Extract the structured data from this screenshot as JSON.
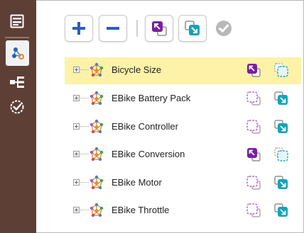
{
  "toolbar": {
    "buttons": [
      {
        "name": "add-button",
        "icon": "plus-icon"
      },
      {
        "name": "remove-button",
        "icon": "minus-icon"
      },
      {
        "name": "move-up-left-button",
        "icon": "arrow-up-left-icon"
      },
      {
        "name": "move-down-right-button",
        "icon": "arrow-down-right-icon"
      },
      {
        "name": "confirm-button",
        "icon": "check-circle-icon"
      }
    ]
  },
  "sidebar": {
    "items": [
      {
        "name": "sidebar-item-form",
        "icon": "form-icon"
      },
      {
        "name": "sidebar-item-rules",
        "icon": "relations-icon",
        "active": true
      },
      {
        "name": "sidebar-item-hierarchy",
        "icon": "hierarchy-icon"
      },
      {
        "name": "sidebar-item-validate",
        "icon": "check-badge-icon"
      }
    ]
  },
  "tree": {
    "rows": [
      {
        "label": "Bicycle Size",
        "selected": true,
        "action_a": "solid",
        "action_b": "dashed"
      },
      {
        "label": "EBike Battery Pack",
        "selected": false,
        "action_a": "dashed",
        "action_b": "solid"
      },
      {
        "label": "EBike Controller",
        "selected": false,
        "action_a": "dashed",
        "action_b": "solid"
      },
      {
        "label": "EBike Conversion",
        "selected": false,
        "action_a": "solid",
        "action_b": "dashed"
      },
      {
        "label": "EBike Motor",
        "selected": false,
        "action_a": "dashed",
        "action_b": "solid"
      },
      {
        "label": "EBike Throttle",
        "selected": false,
        "action_a": "dashed",
        "action_b": "solid"
      }
    ]
  },
  "colors": {
    "sidebar_bg": "#5e3f36",
    "primary_blue": "#2a60b6",
    "purple": "#7a1fa2",
    "teal": "#16a3b8",
    "selection": "#fdf2a8"
  }
}
